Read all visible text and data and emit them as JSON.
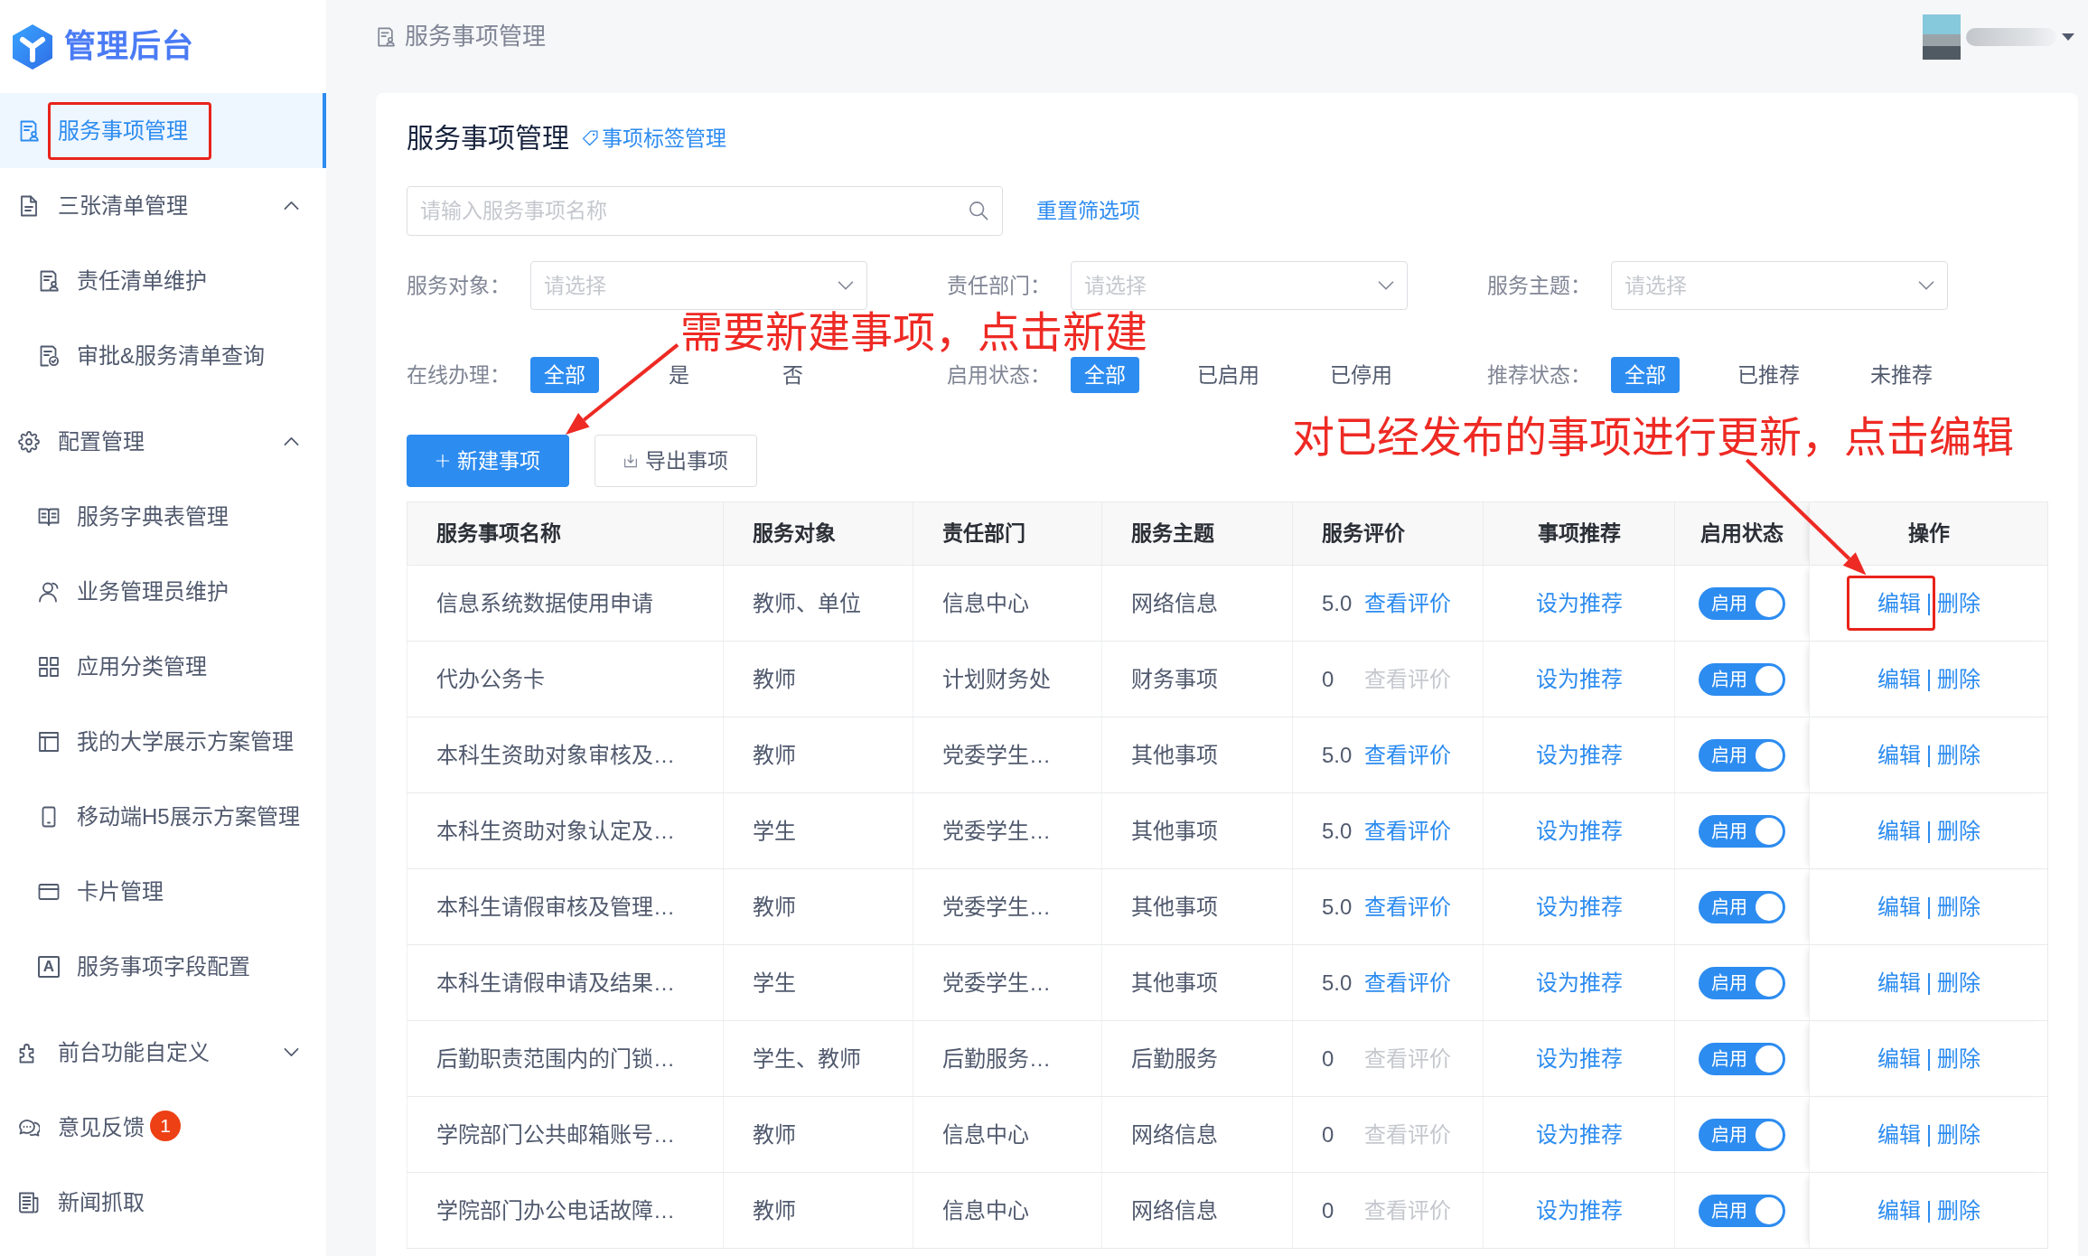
{
  "sidebar": {
    "logo_text": "管理后台",
    "items": [
      {
        "label": "服务事项管理",
        "selected": true,
        "highlighted": true
      },
      {
        "label": "三张清单管理",
        "selected": false,
        "highlighted": false,
        "expanded": true,
        "children": [
          {
            "label": "责任清单维护",
            "selected": false,
            "highlighted": false
          },
          {
            "label": "审批&服务清单查询",
            "selected": false,
            "highlighted": false
          }
        ]
      },
      {
        "label": "配置管理",
        "selected": false,
        "highlighted": false,
        "expanded": true,
        "children": [
          {
            "label": "服务字典表管理",
            "selected": false,
            "highlighted": false
          },
          {
            "label": "业务管理员维护",
            "selected": false,
            "highlighted": false
          },
          {
            "label": "应用分类管理",
            "selected": false,
            "highlighted": false
          },
          {
            "label": "我的大学展示方案管理",
            "selected": false,
            "highlighted": false
          },
          {
            "label": "移动端H5展示方案管理",
            "selected": false,
            "highlighted": false
          },
          {
            "label": "卡片管理",
            "selected": false,
            "highlighted": false
          },
          {
            "label": "服务事项字段配置",
            "selected": false,
            "highlighted": false,
            "icon_glyph": "A"
          }
        ]
      },
      {
        "label": "前台功能自定义",
        "selected": false,
        "highlighted": false,
        "expanded": false
      },
      {
        "label": "意见反馈",
        "selected": false,
        "highlighted": false,
        "badge": "1"
      },
      {
        "label": "新闻抓取",
        "selected": false,
        "highlighted": false
      }
    ]
  },
  "header": {
    "breadcrumb": "服务事项管理"
  },
  "content": {
    "title": "服务事项管理",
    "tag_link": "事项标签管理",
    "search": {
      "placeholder": "请输入服务事项名称"
    },
    "reset_link": "重置筛选项",
    "selects": [
      {
        "label": "服务对象：",
        "placeholder": "请选择"
      },
      {
        "label": "责任部门：",
        "placeholder": "请选择"
      },
      {
        "label": "服务主题：",
        "placeholder": "请选择"
      }
    ],
    "chip_groups": [
      {
        "label": "在线办理：",
        "options": [
          {
            "label": "全部",
            "selected": true
          },
          {
            "label": "是",
            "selected": false
          },
          {
            "label": "否",
            "selected": false
          }
        ]
      },
      {
        "label": "启用状态：",
        "options": [
          {
            "label": "全部",
            "selected": true
          },
          {
            "label": "已启用",
            "selected": false
          },
          {
            "label": "已停用",
            "selected": false
          }
        ]
      },
      {
        "label": "推荐状态：",
        "options": [
          {
            "label": "全部",
            "selected": true
          },
          {
            "label": "已推荐",
            "selected": false
          },
          {
            "label": "未推荐",
            "selected": false
          }
        ]
      }
    ],
    "buttons": [
      {
        "kind": "primary",
        "label": "新建事项"
      },
      {
        "kind": "secondary",
        "label": "导出事项"
      }
    ],
    "table": {
      "columns": [
        "服务事项名称",
        "服务对象",
        "责任部门",
        "服务主题",
        "服务评价",
        "事项推荐",
        "启用状态",
        "操作"
      ],
      "rows": [
        {
          "name": "信息系统数据使用申请",
          "audience": "教师、单位",
          "department": "信息中心",
          "topic": "网络信息",
          "rating": "5.0",
          "review": {
            "label": "查看评价",
            "disabled": false
          },
          "recommend": "设为推荐",
          "status": {
            "label": "启用",
            "on": true
          },
          "actions": [
            "编辑",
            "删除"
          ],
          "highlighted": true
        },
        {
          "name": "代办公务卡",
          "audience": "教师",
          "department": "计划财务处",
          "topic": "财务事项",
          "rating": "0",
          "review": {
            "label": "查看评价",
            "disabled": true
          },
          "recommend": "设为推荐",
          "status": {
            "label": "启用",
            "on": true
          },
          "actions": [
            "编辑",
            "删除"
          ],
          "highlighted": false
        },
        {
          "name": "本科生资助对象审核及…",
          "audience": "教师",
          "department": "党委学生…",
          "topic": "其他事项",
          "rating": "5.0",
          "review": {
            "label": "查看评价",
            "disabled": false
          },
          "recommend": "设为推荐",
          "status": {
            "label": "启用",
            "on": true
          },
          "actions": [
            "编辑",
            "删除"
          ],
          "highlighted": false
        },
        {
          "name": "本科生资助对象认定及…",
          "audience": "学生",
          "department": "党委学生…",
          "topic": "其他事项",
          "rating": "5.0",
          "review": {
            "label": "查看评价",
            "disabled": false
          },
          "recommend": "设为推荐",
          "status": {
            "label": "启用",
            "on": true
          },
          "actions": [
            "编辑",
            "删除"
          ],
          "highlighted": false
        },
        {
          "name": "本科生请假审核及管理…",
          "audience": "教师",
          "department": "党委学生…",
          "topic": "其他事项",
          "rating": "5.0",
          "review": {
            "label": "查看评价",
            "disabled": false
          },
          "recommend": "设为推荐",
          "status": {
            "label": "启用",
            "on": true
          },
          "actions": [
            "编辑",
            "删除"
          ],
          "highlighted": false
        },
        {
          "name": "本科生请假申请及结果…",
          "audience": "学生",
          "department": "党委学生…",
          "topic": "其他事项",
          "rating": "5.0",
          "review": {
            "label": "查看评价",
            "disabled": false
          },
          "recommend": "设为推荐",
          "status": {
            "label": "启用",
            "on": true
          },
          "actions": [
            "编辑",
            "删除"
          ],
          "highlighted": false
        },
        {
          "name": "后勤职责范围内的门锁…",
          "audience": "学生、教师",
          "department": "后勤服务…",
          "topic": "后勤服务",
          "rating": "0",
          "review": {
            "label": "查看评价",
            "disabled": true
          },
          "recommend": "设为推荐",
          "status": {
            "label": "启用",
            "on": true
          },
          "actions": [
            "编辑",
            "删除"
          ],
          "highlighted": false
        },
        {
          "name": "学院部门公共邮箱账号…",
          "audience": "教师",
          "department": "信息中心",
          "topic": "网络信息",
          "rating": "0",
          "review": {
            "label": "查看评价",
            "disabled": true
          },
          "recommend": "设为推荐",
          "status": {
            "label": "启用",
            "on": true
          },
          "actions": [
            "编辑",
            "删除"
          ],
          "highlighted": false
        },
        {
          "name": "学院部门办公电话故障…",
          "audience": "教师",
          "department": "信息中心",
          "topic": "网络信息",
          "rating": "0",
          "review": {
            "label": "查看评价",
            "disabled": true
          },
          "recommend": "设为推荐",
          "status": {
            "label": "启用",
            "on": true
          },
          "actions": [
            "编辑",
            "删除"
          ],
          "highlighted": false
        }
      ]
    }
  },
  "annotations": [
    {
      "text": "需要新建事项，点击新建"
    },
    {
      "text": "对已经发布的事项进行更新，点击编辑"
    }
  ]
}
